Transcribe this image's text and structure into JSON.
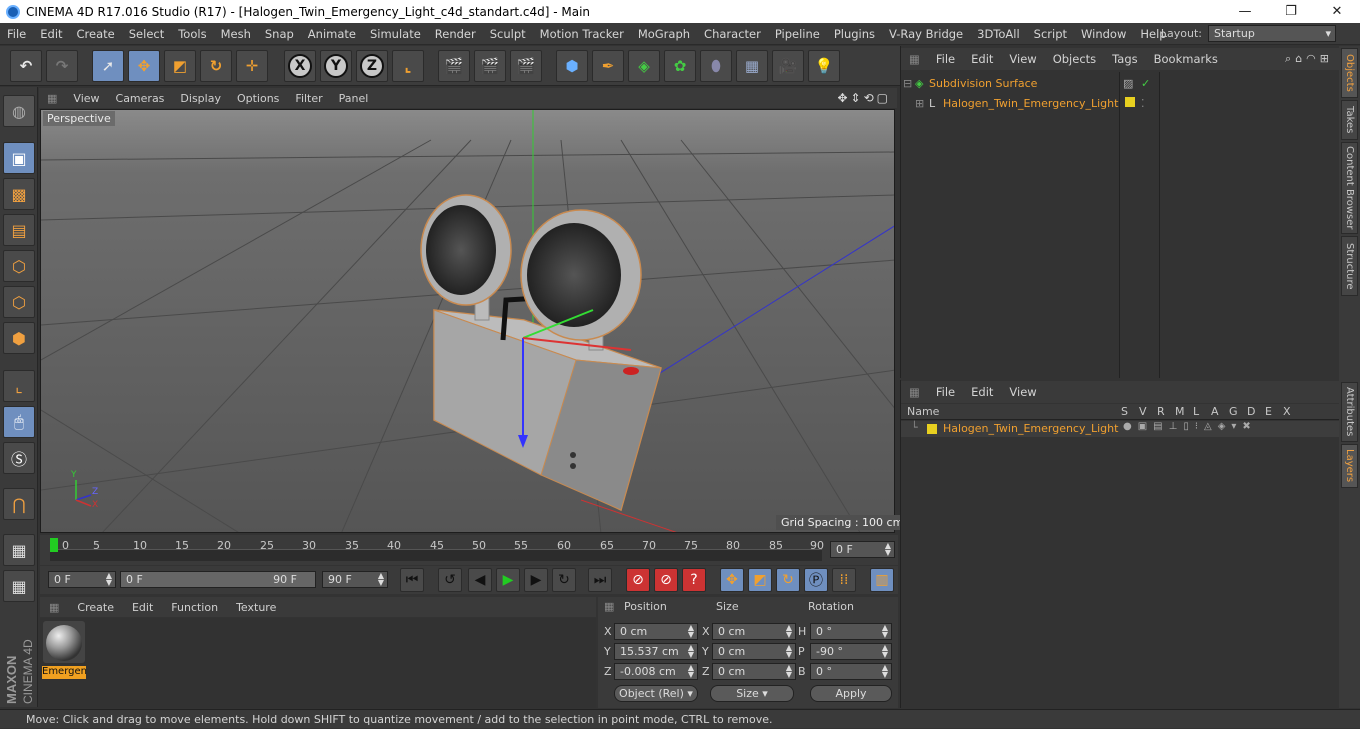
{
  "window": {
    "title": "CINEMA 4D R17.016 Studio (R17) - [Halogen_Twin_Emergency_Light_c4d_standart.c4d] - Main"
  },
  "menubar": {
    "items": [
      "File",
      "Edit",
      "Create",
      "Select",
      "Tools",
      "Mesh",
      "Snap",
      "Animate",
      "Simulate",
      "Render",
      "Sculpt",
      "Motion Tracker",
      "MoGraph",
      "Character",
      "Pipeline",
      "Plugins",
      "V-Ray Bridge",
      "3DToAll",
      "Script",
      "Window",
      "Help"
    ],
    "layout_label": "Layout:",
    "layout_value": "Startup"
  },
  "viewport": {
    "menu": [
      "View",
      "Cameras",
      "Display",
      "Options",
      "Filter",
      "Panel"
    ],
    "label": "Perspective",
    "grid_spacing": "Grid Spacing : 100 cm",
    "axis_labels": {
      "y": "Y",
      "z": "Z",
      "x": "X"
    }
  },
  "timeline": {
    "ticks": [
      "0",
      "5",
      "10",
      "15",
      "20",
      "25",
      "30",
      "35",
      "40",
      "45",
      "50",
      "55",
      "60",
      "65",
      "70",
      "75",
      "80",
      "85",
      "90"
    ],
    "current_frame": "0 F",
    "start_field": "0 F",
    "range_start": "0 F",
    "range_end": "90 F",
    "end_field": "90 F"
  },
  "material": {
    "menu": [
      "Create",
      "Edit",
      "Function",
      "Texture"
    ],
    "name": "Emergen"
  },
  "coords": {
    "headers": {
      "position": "Position",
      "size": "Size",
      "rotation": "Rotation"
    },
    "rows": [
      {
        "axis": "X",
        "pos": "0 cm",
        "saxis": "X",
        "size": "0 cm",
        "raxis": "H",
        "rot": "0 °"
      },
      {
        "axis": "Y",
        "pos": "15.537 cm",
        "saxis": "Y",
        "size": "0 cm",
        "raxis": "P",
        "rot": "-90 °"
      },
      {
        "axis": "Z",
        "pos": "-0.008 cm",
        "saxis": "Z",
        "size": "0 cm",
        "raxis": "B",
        "rot": "0 °"
      }
    ],
    "mode": "Object (Rel)",
    "size_mode": "Size",
    "apply": "Apply"
  },
  "objects": {
    "menu": [
      "File",
      "Edit",
      "View",
      "Objects",
      "Tags",
      "Bookmarks"
    ],
    "items": [
      {
        "name": "Subdivision Surface"
      },
      {
        "name": "Halogen_Twin_Emergency_Light"
      }
    ]
  },
  "layers": {
    "menu": [
      "File",
      "Edit",
      "View"
    ],
    "name_header": "Name",
    "columns": [
      "S",
      "V",
      "R",
      "M",
      "L",
      "A",
      "G",
      "D",
      "E",
      "X"
    ],
    "row": "Halogen_Twin_Emergency_Light"
  },
  "side_tabs": [
    "Objects",
    "Takes",
    "Content Browser",
    "Structure",
    "Attributes",
    "Layers"
  ],
  "brand": {
    "maxon": "MAXON",
    "cinema": "CINEMA 4D"
  },
  "status": "Move: Click and drag to move elements. Hold down SHIFT to quantize movement / add to the selection in point mode, CTRL to remove.",
  "colors": {
    "accent": "#f0a030",
    "selected": "#6f8fbf",
    "layer": "#e8d020"
  }
}
